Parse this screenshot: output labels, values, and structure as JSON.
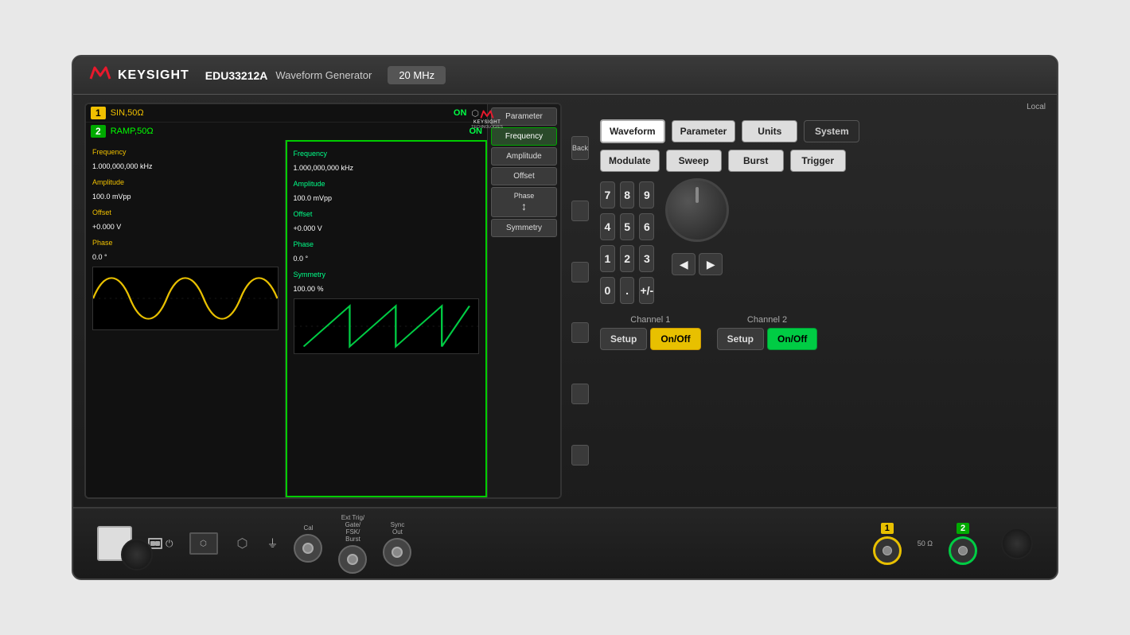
{
  "instrument": {
    "brand": "KEYSIGHT",
    "model": "EDU33212A",
    "description": "Waveform Generator",
    "frequency": "20 MHz"
  },
  "display": {
    "usb_symbol": "⬡",
    "ch1": {
      "label": "1",
      "type": "SIN,50Ω",
      "status": "ON",
      "params": {
        "frequency_label": "Frequency",
        "frequency_value": "1.000,000,000 kHz",
        "amplitude_label": "Amplitude",
        "amplitude_value": "100.0 mVpp",
        "offset_label": "Offset",
        "offset_value": "+0.000 V",
        "phase_label": "Phase",
        "phase_value": "0.0 °"
      }
    },
    "ch2": {
      "label": "2",
      "type": "RAMP,50Ω",
      "status": "ON",
      "params": {
        "frequency_label": "Frequency",
        "frequency_value": "1.000,000,000 kHz",
        "amplitude_label": "Amplitude",
        "amplitude_value": "100.0 mVpp",
        "offset_label": "Offset",
        "offset_value": "+0.000 V",
        "phase_label": "Phase",
        "phase_value": "0.0 °",
        "symmetry_label": "Symmetry",
        "symmetry_value": "100.00 %"
      }
    },
    "menu": {
      "parameter": "Parameter",
      "frequency": "Frequency",
      "amplitude": "Amplitude",
      "offset": "Offset",
      "phase": "Phase ↕",
      "symmetry": "Symmetry"
    },
    "back": "Back"
  },
  "controls": {
    "local_label": "Local",
    "buttons": {
      "waveform": "Waveform",
      "parameter": "Parameter",
      "units": "Units",
      "system": "System",
      "modulate": "Modulate",
      "sweep": "Sweep",
      "burst": "Burst",
      "trigger": "Trigger"
    },
    "numpad": {
      "keys": [
        "7",
        "8",
        "9",
        "4",
        "5",
        "6",
        "1",
        "2",
        "3",
        "0",
        ".",
        "+/-"
      ]
    },
    "channel1": {
      "label": "Channel 1",
      "setup": "Setup",
      "onoff": "On/Off"
    },
    "channel2": {
      "label": "Channel 2",
      "setup": "Setup",
      "onoff": "On/Off"
    }
  },
  "bottom": {
    "cal_label": "Cal",
    "ext_trig_label": "Ext Trig/\nGate/\nFSK/\nBurst",
    "sync_label": "Sync\nOut",
    "ch1_label": "1",
    "resistance_label": "50 Ω",
    "ch2_label": "2"
  }
}
